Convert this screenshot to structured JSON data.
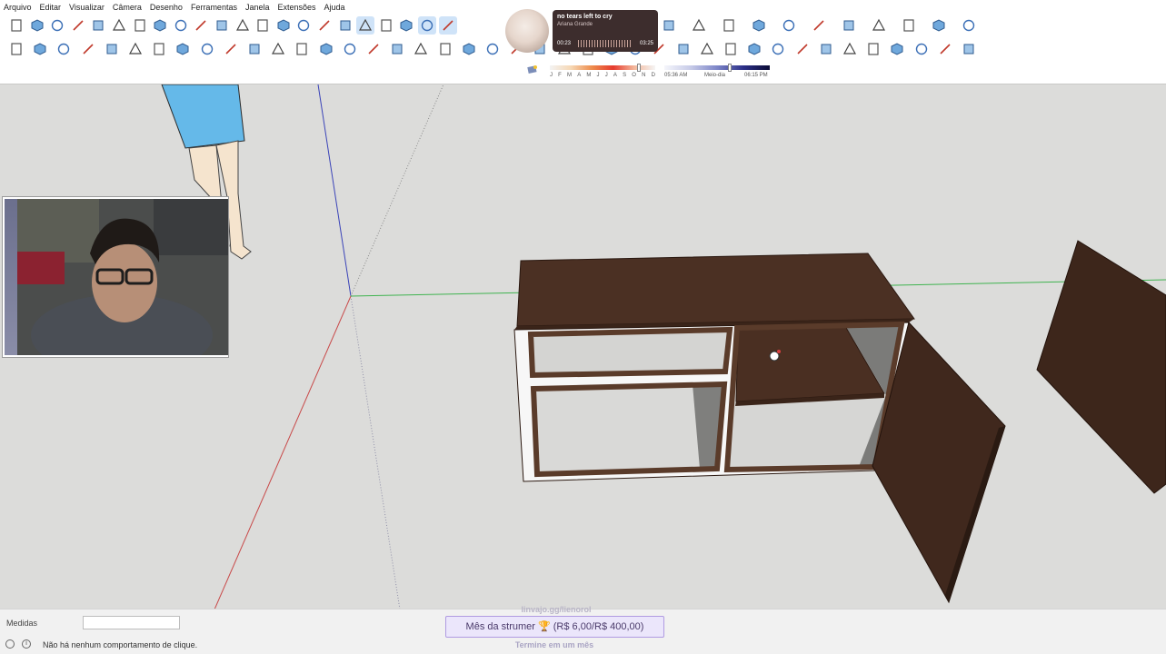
{
  "menu": [
    "Arquivo",
    "Editar",
    "Visualizar",
    "Câmera",
    "Desenho",
    "Ferramentas",
    "Janela",
    "Extensões",
    "Ajuda"
  ],
  "toolbar1_icons": [
    "new-icon",
    "open-icon",
    "save-icon",
    "cut-icon",
    "copy-icon",
    "paste-icon",
    "erase-icon",
    "undo-icon",
    "redo-icon",
    "print-icon",
    "model-info-icon",
    "iso-view-icon",
    "top-view-icon",
    "front-view-icon",
    "right-view-icon",
    "back-view-icon",
    "left-view-icon",
    "xray-icon",
    "back-edges-icon",
    "wireframe-icon",
    "hidden-line-icon",
    "shaded-icon",
    "shaded-textures-icon",
    "monochrome-icon",
    "section-plane-icon",
    "extension-warehouse-icon",
    "components-icon",
    "styles-icon",
    "layers-icon",
    "outliner-icon",
    "scenes-icon",
    "settings-icon",
    "user-icon"
  ],
  "toolbar2_icons": [
    "select-icon",
    "make-component-icon",
    "paint-bucket-icon",
    "eraser-icon",
    "line-icon",
    "freehand-icon",
    "rectangle-icon",
    "rotated-rectangle-icon",
    "circle-icon",
    "polygon-icon",
    "arc-icon",
    "two-point-arc-icon",
    "pie-icon",
    "push-pull-icon",
    "move-icon",
    "rotate-icon",
    "scale-icon",
    "offset-icon",
    "follow-me-icon",
    "intersect-icon",
    "tape-measure-icon",
    "protractor-icon",
    "axes-icon",
    "dimension-icon",
    "text-icon",
    "3d-text-icon",
    "orbit-icon",
    "pan-icon",
    "zoom-icon",
    "zoom-window-icon",
    "zoom-extents-icon",
    "previous-view-icon",
    "position-camera-icon",
    "look-around-icon",
    "walk-icon",
    "section-icon",
    "sandbox-icon",
    "solid-tools-icon",
    "mirror-icon",
    "bend-icon",
    "dimension-tool-icon"
  ],
  "shadows": {
    "months": [
      "J",
      "F",
      "M",
      "A",
      "M",
      "J",
      "J",
      "A",
      "S",
      "O",
      "N",
      "D"
    ],
    "time_start": "05:36 AM",
    "time_mid": "Meio-dia",
    "time_end": "06:15 PM"
  },
  "music": {
    "title": "no tears left to cry",
    "artist": "Ariana Grande",
    "elapsed": "00:23",
    "total": "03:25"
  },
  "statusbar": {
    "measure_label": "Medidas",
    "measure_value": "",
    "status_text": "Não há nenhum comportamento de clique.",
    "sub_link": "linvajo.gg/lienorol",
    "goal_text": "Mês da strumer 🏆 (R$ 6,00/R$ 400,00)",
    "goal_sub": "Termine em um mês"
  }
}
